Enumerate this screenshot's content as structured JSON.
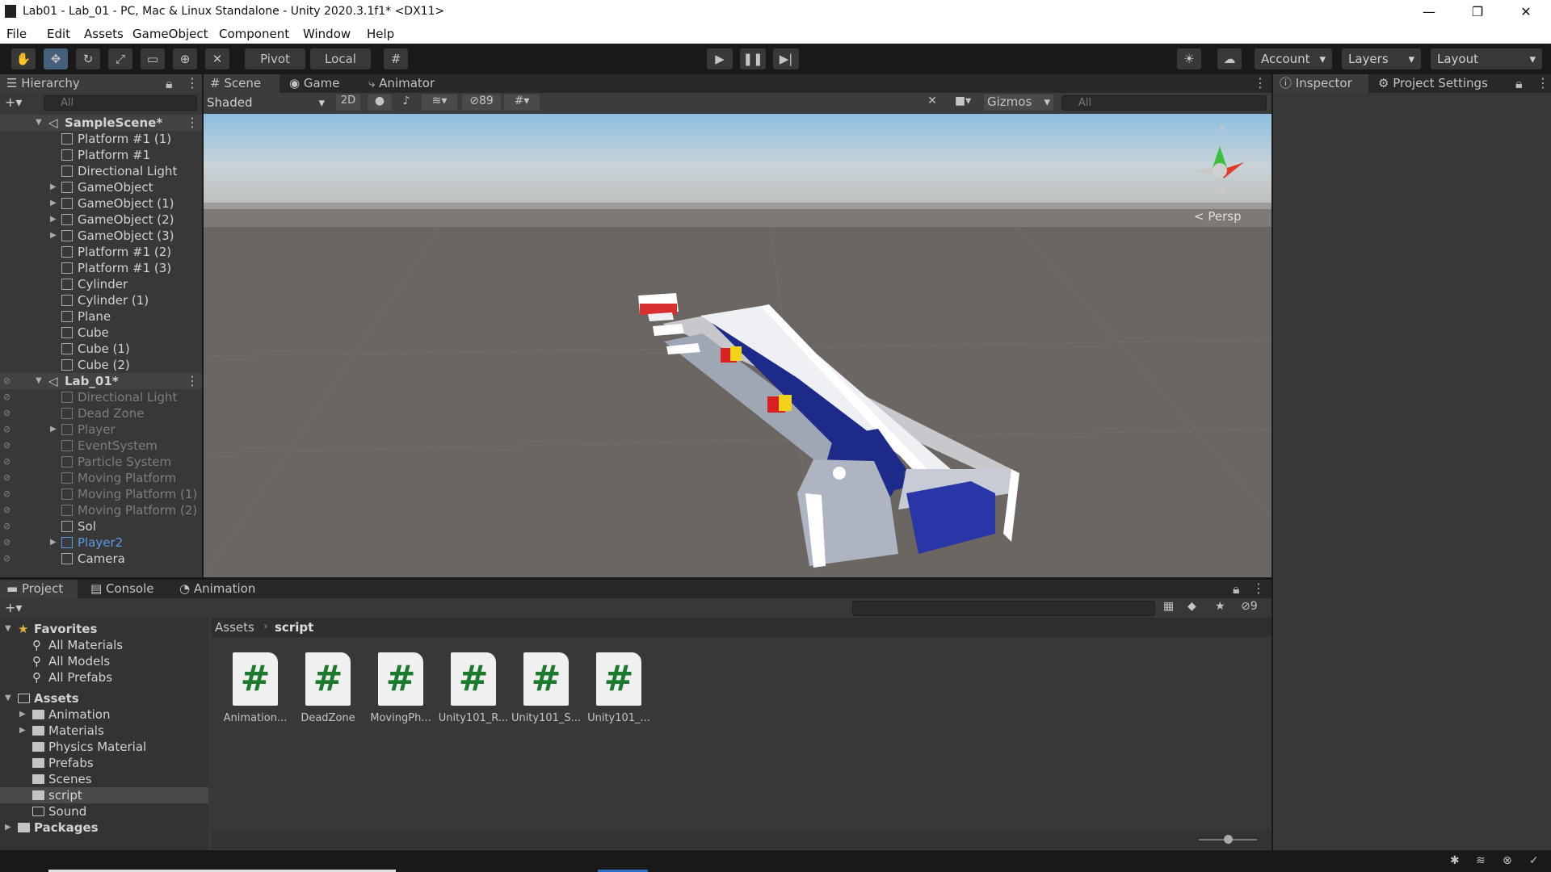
{
  "window": {
    "title": "Lab01 - Lab_01 - PC, Mac & Linux Standalone - Unity 2020.3.1f1* <DX11>",
    "minimize": "—",
    "maximize": "❐",
    "close": "✕"
  },
  "menu": [
    "File",
    "Edit",
    "Assets",
    "GameObject",
    "Component",
    "Window",
    "Help"
  ],
  "toolbar": {
    "pivot": "Pivot",
    "local": "Local",
    "account": "Account",
    "layers": "Layers",
    "layout": "Layout"
  },
  "hierarchy": {
    "title": "Hierarchy",
    "search_placeholder": "All",
    "scene1": "SampleScene*",
    "scene1_items": [
      "Platform #1 (1)",
      "Platform #1",
      "Directional Light",
      "GameObject",
      "GameObject (1)",
      "GameObject (2)",
      "GameObject (3)",
      "Platform #1 (2)",
      "Platform #1 (3)",
      "Cylinder",
      "Cylinder (1)",
      "Plane",
      "Cube",
      "Cube (1)",
      "Cube (2)"
    ],
    "scene2": "Lab_01*",
    "scene2_items": [
      "Directional Light",
      "Dead Zone",
      "Player",
      "EventSystem",
      "Particle System",
      "Moving Platform",
      "Moving Platform (1)",
      "Moving Platform (2)",
      "Sol",
      "Player2",
      "Camera"
    ]
  },
  "scene_tabs": {
    "scene": "Scene",
    "game": "Game",
    "animator": "Animator"
  },
  "scene_bar": {
    "shading": "Shaded",
    "mode2d": "2D",
    "hidden_count": "89",
    "gizmos": "Gizmos",
    "search_placeholder": "All",
    "persp": "Persp",
    "axis_y": "y",
    "axis_x": "x"
  },
  "inspector": {
    "tab1": "Inspector",
    "tab2": "Project Settings"
  },
  "bottom_tabs": {
    "project": "Project",
    "console": "Console",
    "animation": "Animation",
    "hidden_count": "9"
  },
  "project": {
    "favorites": "Favorites",
    "fav_items": [
      "All Materials",
      "All Models",
      "All Prefabs"
    ],
    "assets": "Assets",
    "asset_folders": [
      "Animation",
      "Materials",
      "Physics Material",
      "Prefabs",
      "Scenes",
      "script",
      "Sound"
    ],
    "packages": "Packages",
    "breadcrumb": [
      "Assets",
      "script"
    ],
    "files": [
      "Animation...",
      "DeadZone",
      "MovingPh...",
      "Unity101_R...",
      "Unity101_S...",
      "Unity101_..."
    ]
  },
  "colors": {
    "accent": "#46607c",
    "selected_row": "#2c5d87",
    "blue_text": "#5d9be8"
  }
}
